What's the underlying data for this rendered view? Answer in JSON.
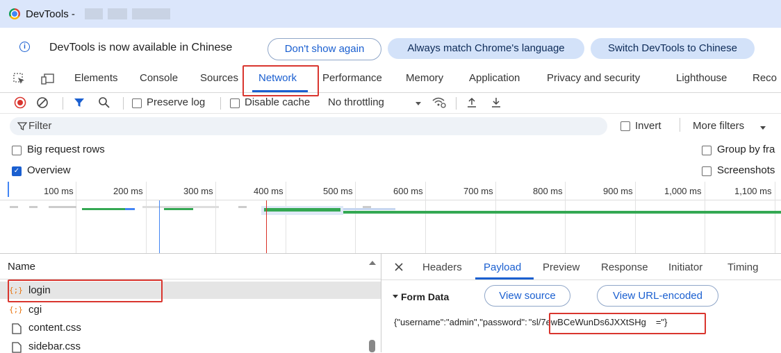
{
  "window": {
    "title": "DevTools -"
  },
  "infobar": {
    "message": "DevTools is now available in Chinese",
    "dont_show": "Don't show again",
    "always_match": "Always match Chrome's language",
    "switch_lang": "Switch DevTools to Chinese"
  },
  "tabs": [
    "Elements",
    "Console",
    "Sources",
    "Network",
    "Performance",
    "Memory",
    "Application",
    "Privacy and security",
    "Lighthouse",
    "Reco"
  ],
  "active_tab": "Network",
  "toolbar": {
    "preserve_log": "Preserve log",
    "disable_cache": "Disable cache",
    "throttling": "No throttling"
  },
  "filter": {
    "placeholder": "Filter",
    "invert": "Invert",
    "more_filters": "More filters"
  },
  "options": {
    "big_rows": "Big request rows",
    "group_by": "Group by fra",
    "overview": "Overview",
    "screenshots": "Screenshots"
  },
  "timeline": {
    "ticks": [
      "100 ms",
      "200 ms",
      "300 ms",
      "400 ms",
      "500 ms",
      "600 ms",
      "700 ms",
      "800 ms",
      "900 ms",
      "1,000 ms",
      "1,100 ms"
    ]
  },
  "requests": {
    "header": "Name",
    "rows": [
      {
        "name": "login",
        "icon": "json-icon"
      },
      {
        "name": "cgi",
        "icon": "json-icon"
      },
      {
        "name": "content.css",
        "icon": "file-icon"
      },
      {
        "name": "sidebar.css",
        "icon": "file-icon"
      }
    ]
  },
  "details": {
    "tabs": [
      "Headers",
      "Payload",
      "Preview",
      "Response",
      "Initiator",
      "Timing"
    ],
    "active_tab": "Payload",
    "section": "Form Data",
    "view_source": "View source",
    "view_url": "View URL-encoded",
    "payload_prefix": "{\"username\":\"admin\",\"password\":",
    "payload_value": "\"sl/7ewBCeWunDs6JXXtSHg",
    "payload_suffix": "=\"}"
  },
  "colors": {
    "accent": "#1a5fd0",
    "highlight": "#d9352e",
    "bar_green": "#34a853"
  }
}
